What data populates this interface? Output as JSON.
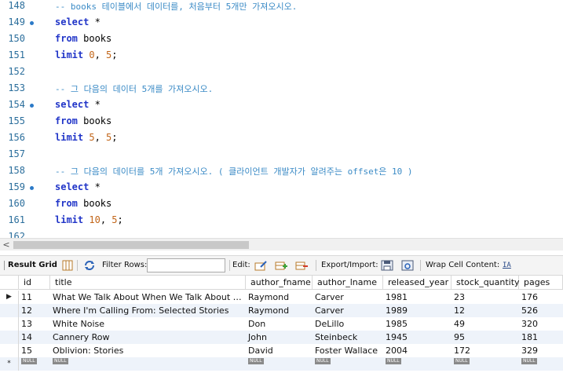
{
  "editor": {
    "lines": [
      {
        "num": "148",
        "marker": false,
        "tokens": [
          {
            "t": "comment",
            "v": "-- books 테이블에서 데이터를, 처음부터 5개만 가져오시오."
          }
        ]
      },
      {
        "num": "149",
        "marker": true,
        "tokens": [
          {
            "t": "keyword",
            "v": "select"
          },
          {
            "t": "punct",
            "v": " *"
          }
        ]
      },
      {
        "num": "150",
        "marker": false,
        "tokens": [
          {
            "t": "keyword",
            "v": "from"
          },
          {
            "t": "ident",
            "v": " books"
          }
        ]
      },
      {
        "num": "151",
        "marker": false,
        "tokens": [
          {
            "t": "keyword",
            "v": "limit"
          },
          {
            "t": "punct",
            "v": " "
          },
          {
            "t": "number",
            "v": "0"
          },
          {
            "t": "punct",
            "v": ", "
          },
          {
            "t": "number",
            "v": "5"
          },
          {
            "t": "punct",
            "v": ";"
          }
        ]
      },
      {
        "num": "152",
        "marker": false,
        "tokens": []
      },
      {
        "num": "153",
        "marker": false,
        "tokens": [
          {
            "t": "comment",
            "v": "-- 그 다음의 데이터 5개를 가져오시오."
          }
        ]
      },
      {
        "num": "154",
        "marker": true,
        "tokens": [
          {
            "t": "keyword",
            "v": "select"
          },
          {
            "t": "punct",
            "v": " *"
          }
        ]
      },
      {
        "num": "155",
        "marker": false,
        "tokens": [
          {
            "t": "keyword",
            "v": "from"
          },
          {
            "t": "ident",
            "v": " books"
          }
        ]
      },
      {
        "num": "156",
        "marker": false,
        "tokens": [
          {
            "t": "keyword",
            "v": "limit"
          },
          {
            "t": "punct",
            "v": " "
          },
          {
            "t": "number",
            "v": "5"
          },
          {
            "t": "punct",
            "v": ", "
          },
          {
            "t": "number",
            "v": "5"
          },
          {
            "t": "punct",
            "v": ";"
          }
        ]
      },
      {
        "num": "157",
        "marker": false,
        "tokens": []
      },
      {
        "num": "158",
        "marker": false,
        "tokens": [
          {
            "t": "comment",
            "v": "-- 그 다음의 데이터를 5개 가져오시오. ( 클라이언트 개발자가 알려주는 offset은 10 )"
          }
        ]
      },
      {
        "num": "159",
        "marker": true,
        "tokens": [
          {
            "t": "keyword",
            "v": "select"
          },
          {
            "t": "punct",
            "v": " *"
          }
        ]
      },
      {
        "num": "160",
        "marker": false,
        "tokens": [
          {
            "t": "keyword",
            "v": "from"
          },
          {
            "t": "ident",
            "v": " books"
          }
        ]
      },
      {
        "num": "161",
        "marker": false,
        "tokens": [
          {
            "t": "keyword",
            "v": "limit"
          },
          {
            "t": "punct",
            "v": " "
          },
          {
            "t": "number",
            "v": "10"
          },
          {
            "t": "punct",
            "v": ", "
          },
          {
            "t": "number",
            "v": "5"
          },
          {
            "t": "punct",
            "v": ";"
          }
        ]
      },
      {
        "num": "162",
        "marker": false,
        "tokens": []
      }
    ]
  },
  "scroll": {
    "left_arrow": "<"
  },
  "toolbar": {
    "result_grid": "Result Grid",
    "filter_rows": "Filter Rows:",
    "edit": "Edit:",
    "export_import": "Export/Import:",
    "wrap_cell": "Wrap Cell Content:",
    "wrap_icon_glyph": "IA"
  },
  "grid": {
    "columns": [
      "id",
      "title",
      "author_fname",
      "author_lname",
      "released_year",
      "stock_quantity",
      "pages"
    ],
    "rows": [
      [
        "11",
        "What We Talk About When We Talk About Love: Stories",
        "Raymond",
        "Carver",
        "1981",
        "23",
        "176"
      ],
      [
        "12",
        "Where I'm Calling From: Selected Stories",
        "Raymond",
        "Carver",
        "1989",
        "12",
        "526"
      ],
      [
        "13",
        "White Noise",
        "Don",
        "DeLillo",
        "1985",
        "49",
        "320"
      ],
      [
        "14",
        "Cannery Row",
        "John",
        "Steinbeck",
        "1945",
        "95",
        "181"
      ],
      [
        "15",
        "Oblivion: Stories",
        "David",
        "Foster Wallace",
        "2004",
        "172",
        "329"
      ]
    ],
    "current_row_marker": "▶",
    "new_row_marker": "*",
    "null_label": "NULL"
  }
}
